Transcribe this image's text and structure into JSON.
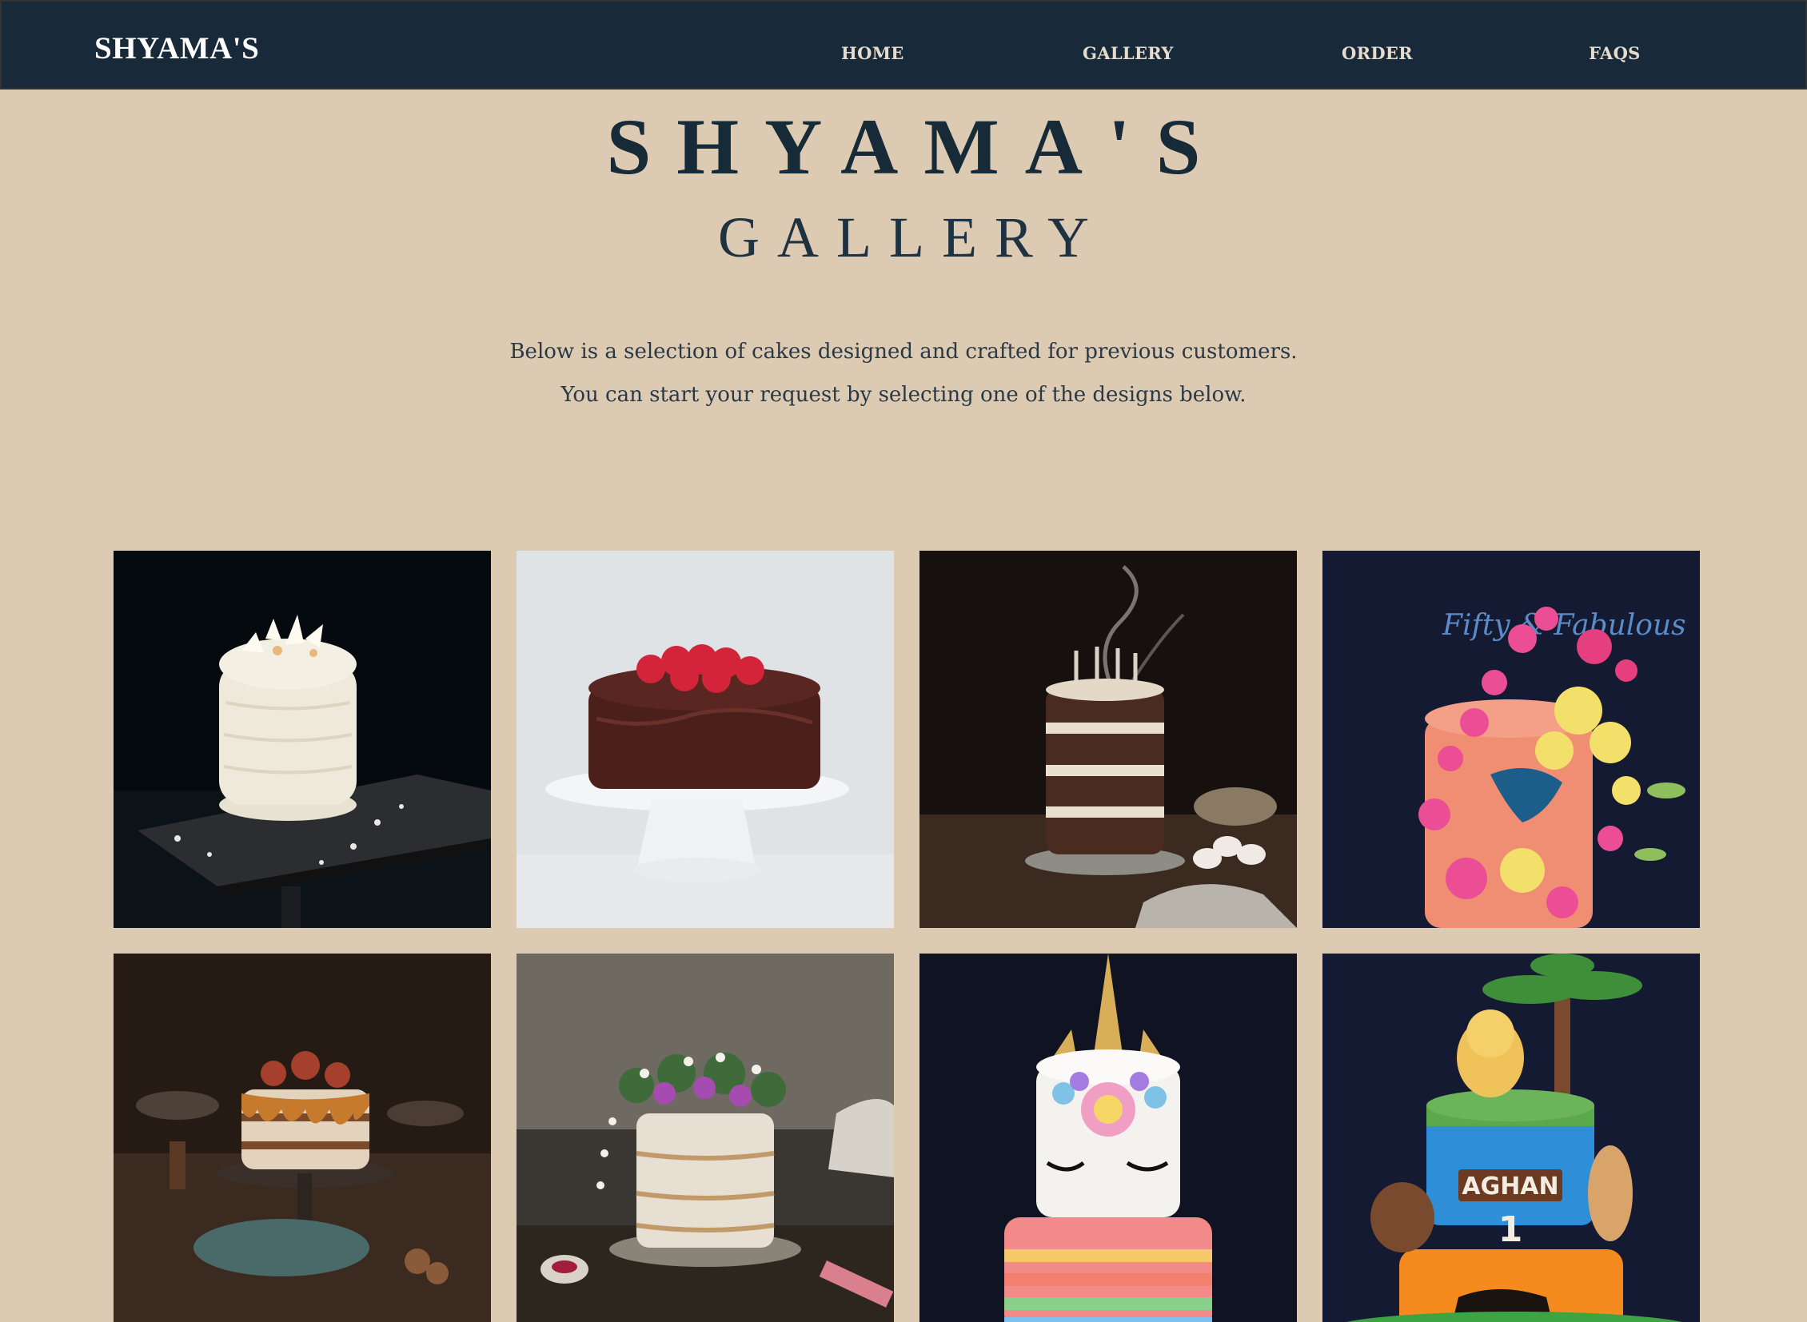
{
  "nav": {
    "brand": "SHYAMA'S",
    "items": [
      "HOME",
      "GALLERY",
      "ORDER",
      "FAQS"
    ]
  },
  "hero": {
    "title": "SHYAMA'S",
    "subtitle": "GALLERY"
  },
  "intro": {
    "line1": "Below is a selection of cakes designed and crafted for previous customers.",
    "line2": "You can start your request by selecting one of the designs below."
  },
  "gallery": {
    "topper_text": "Fifty & Fabulous",
    "cake_name_text": "AGHAN",
    "cake_age_text": "1",
    "items": [
      {
        "name": "white-frosted-cake"
      },
      {
        "name": "chocolate-raspberry-cake"
      },
      {
        "name": "layered-birthday-cake"
      },
      {
        "name": "fifty-fabulous-flower-cake"
      },
      {
        "name": "fig-caramel-cake"
      },
      {
        "name": "floral-naked-cake"
      },
      {
        "name": "unicorn-cake"
      },
      {
        "name": "lion-king-cake"
      }
    ]
  },
  "colors": {
    "background": "#dccbb2",
    "navbar": "#182a39",
    "heading": "#162a38"
  }
}
